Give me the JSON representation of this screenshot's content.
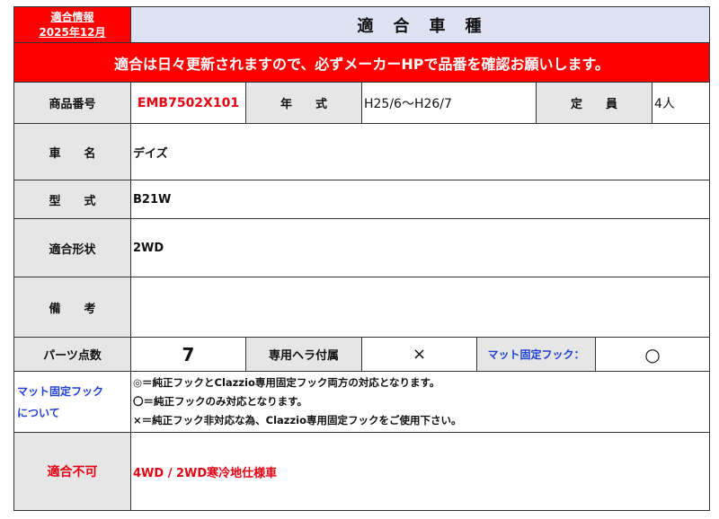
{
  "header": {
    "info_line1": "適合情報",
    "info_line2": "2025年12月",
    "title": "適　合　車　種",
    "banner": "適合は日々更新されますので、必ずメーカーHPで品番を確認お願いします。"
  },
  "row1": {
    "product_label": "商品番号",
    "product_value": "EMB7502X101",
    "year_label": "年　　式",
    "year_value": "H25/6～H26/7",
    "capacity_label": "定　　員",
    "capacity_value": "4人"
  },
  "vehicle": {
    "label": "車　　名",
    "value": "デイズ"
  },
  "model": {
    "label": "型　　式",
    "value": "B21W"
  },
  "drive": {
    "label": "適合形状",
    "value": "2WD"
  },
  "remarks": {
    "label": "備　　考",
    "value": ""
  },
  "parts": {
    "count_label": "パーツ点数",
    "count_value": "7",
    "spatula_label": "専用ヘラ付属",
    "spatula_value": "×",
    "hook_label": "マット固定フック：",
    "hook_value": "○"
  },
  "hook_note": {
    "label_line1": "マット固定フック",
    "label_line2": "について",
    "lines": [
      "◎＝純正フックとClazzio専用固定フック両方の対応となります。",
      "〇＝純正フックのみ対応となります。",
      "×＝純正フック非対応な為、Clazzio専用固定フックをご使用下さい。"
    ]
  },
  "incompatible": {
    "label": "適合不可",
    "value": "4WD / 2WD寒冷地仕様車"
  },
  "colors": {
    "red": "#ff0000",
    "dark_red": "#e60012",
    "blue": "#1f3fd0",
    "header_bg": "#dde3f2",
    "gray": "#e6e6e6"
  }
}
